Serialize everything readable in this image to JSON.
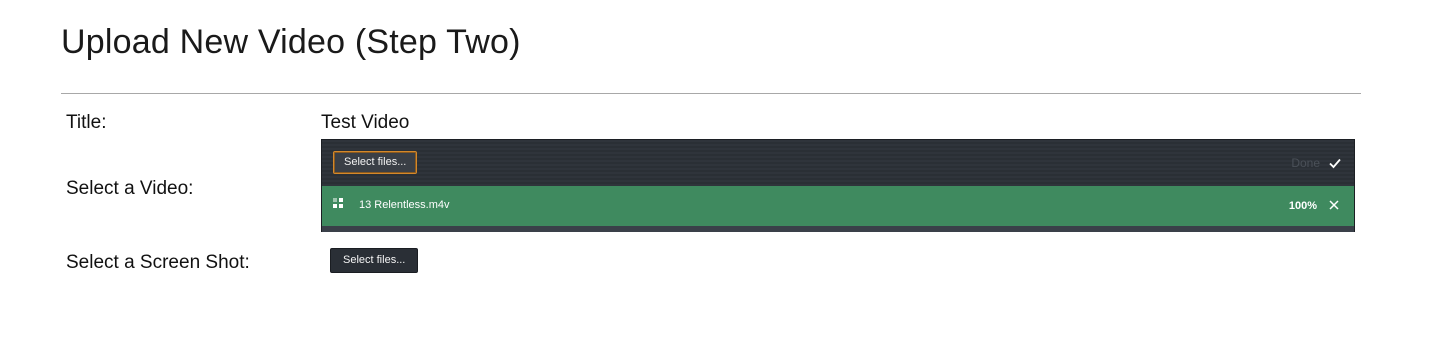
{
  "page": {
    "title": "Upload New Video (Step Two)"
  },
  "form": {
    "title_label": "Title:",
    "title_value": "Test Video",
    "video_label": "Select a Video:",
    "screenshot_label": "Select a Screen Shot:"
  },
  "video_upload": {
    "select_button": "Select files...",
    "done_label": "Done",
    "file": {
      "name": "13 Relentless.m4v",
      "progress_text": "100%",
      "progress": 1.0
    },
    "colors": {
      "panel": "#2d3239",
      "success_row": "#3f8a5f",
      "focus_border": "#d4882a"
    },
    "icons": {
      "file_status": "file-icon",
      "done": "check-icon",
      "remove": "close-icon"
    }
  },
  "screenshot_upload": {
    "select_button": "Select files..."
  }
}
